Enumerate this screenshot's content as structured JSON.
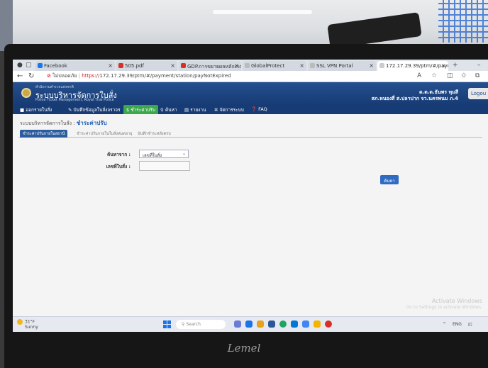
{
  "browser": {
    "tabs": [
      {
        "label": "Facebook",
        "color": "#1877f2",
        "active": false
      },
      {
        "label": "505.pdf",
        "color": "#d93025",
        "active": false
      },
      {
        "label": "GDP.การขยายผลหลักเกณฑ์",
        "color": "#d93025",
        "active": false
      },
      {
        "label": "GlobalProtect",
        "color": "#888888",
        "active": false
      },
      {
        "label": "SSL VPN Portal",
        "color": "#888888",
        "active": false
      },
      {
        "label": "172.17.29.39/ptm/#/payme",
        "color": "#888888",
        "active": true
      }
    ],
    "security_label": "ไม่ปลอดภัย",
    "url_scheme": "https://",
    "url_rest": "172.17.29.39/ptm/#/payment/station/payNotExpired"
  },
  "app": {
    "agency": "สำนักงานตำรวจแห่งชาติ",
    "system_name": "ระบบบริหารจัดการใบสั่ง",
    "system_sub": "Police Ticket Management, Royal Thai Police",
    "user_line1": "ด.ต.ต.ธันพร ทุมสี",
    "user_line2": "สภ.หนองสี่ ส.ปลาปาก จว.นครพนม ภ.4",
    "logout_label": "Logou"
  },
  "menu": [
    {
      "label": "ออกรายใบสั่ง",
      "active": false
    },
    {
      "label": "บันทึกข้อมูลใบสั่งจราจร",
      "active": false
    },
    {
      "label": "ชำระค่าปรับ",
      "active": true
    },
    {
      "label": "ค้นหา",
      "active": false
    },
    {
      "label": "รายงาน",
      "active": false
    },
    {
      "label": "จัดการระบบ",
      "active": false
    },
    {
      "label": "FAQ",
      "active": false
    }
  ],
  "breadcrumb": {
    "parent": "ระบบบริหารจัดการใบสั่ง :",
    "current": "ชำระค่าปรับ"
  },
  "subtabs": [
    {
      "label": "ชำระค่าปรับภายในสถานี",
      "active": true
    },
    {
      "label": "ชำระค่าปรับภายในใบสั่งหมดอายุ",
      "active": false
    },
    {
      "label": "บันทึกชำระหลังครบ",
      "active": false
    }
  ],
  "form": {
    "search_by_label": "ค้นหาจาก :",
    "search_by_value": "เลขที่ใบสั่ง",
    "ticket_no_label": "เลขที่ใบสั่ง :",
    "ticket_no_value": "",
    "search_button": "ค้นหา"
  },
  "watermark": {
    "line1": "Activate Windows",
    "line2": "Go to Settings to activate Windows."
  },
  "taskbar": {
    "weather_temp": "31°F",
    "weather_desc": "Sunny",
    "search_placeholder": "Search",
    "tray_lang": "ENG",
    "app_icons": [
      "#6b7bd6",
      "#1a73e8",
      "#e8a21a",
      "#2b579a",
      "#1fa463",
      "#0078d4",
      "#4285f4",
      "#f4b400",
      "#d93025"
    ]
  },
  "monitor_brand": "Lemel"
}
